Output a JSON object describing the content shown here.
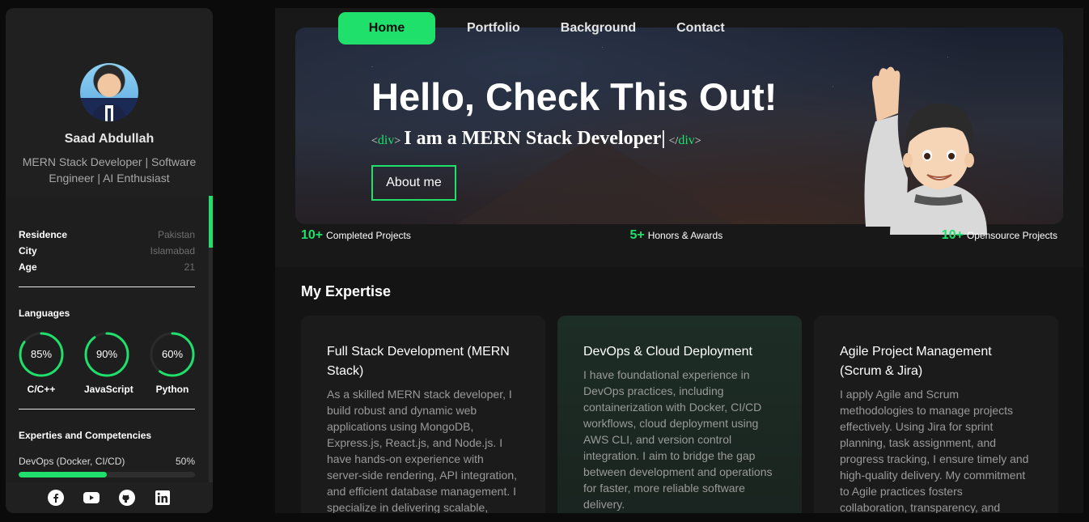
{
  "profile": {
    "name": "Saad Abdullah",
    "role": "MERN Stack Developer | Software Engineer | AI Enthusiast"
  },
  "info": [
    {
      "label": "Residence",
      "value": "Pakistan"
    },
    {
      "label": "City",
      "value": "Islamabad"
    },
    {
      "label": "Age",
      "value": "21"
    }
  ],
  "languages": {
    "title": "Languages",
    "items": [
      {
        "name": "C/C++",
        "percent": "85%",
        "value": 85
      },
      {
        "name": "JavaScript",
        "percent": "90%",
        "value": 90
      },
      {
        "name": "Python",
        "percent": "60%",
        "value": 60
      }
    ]
  },
  "expertise_sidebar": {
    "title": "Experties and Competencies",
    "items": [
      {
        "name": "DevOps (Docker, CI/CD)",
        "percent": "50%",
        "value": 50
      }
    ]
  },
  "socials": [
    "facebook-icon",
    "youtube-icon",
    "github-icon",
    "linkedin-icon"
  ],
  "nav": {
    "items": [
      "Home",
      "Portfolio",
      "Background",
      "Contact"
    ],
    "active": "Home"
  },
  "hero": {
    "title": "Hello, Check This Out!",
    "tag_open": "<",
    "tag_name": "div",
    "tag_close": ">",
    "tagline": "I am a MERN Stack Developer|",
    "end_tag_open": "</",
    "button": "About me"
  },
  "stats": [
    {
      "num": "10+",
      "label": "Completed Projects"
    },
    {
      "num": "5+",
      "label": "Honors & Awards"
    },
    {
      "num": "10+",
      "label": "Opensource Projects"
    }
  ],
  "expertise": {
    "title": "My Expertise",
    "cards": [
      {
        "title": "Full Stack Development (MERN Stack)",
        "text": "As a skilled MERN stack developer, I build robust and dynamic web applications using MongoDB, Express.js, React.js, and Node.js. I have hands-on experience with server-side rendering, API integration, and efficient database management. I specialize in delivering scalable,"
      },
      {
        "title": "DevOps & Cloud Deployment",
        "text": "I have foundational experience in DevOps practices, including containerization with Docker, CI/CD workflows, cloud deployment using AWS CLI, and version control integration. I aim to bridge the gap between development and operations for faster, more reliable software delivery."
      },
      {
        "title": "Agile Project Management (Scrum & Jira)",
        "text": "I apply Agile and Scrum methodologies to manage projects effectively. Using Jira for sprint planning, task assignment, and progress tracking, I ensure timely and high-quality delivery. My commitment to Agile practices fosters collaboration, transparency, and"
      }
    ]
  },
  "colors": {
    "accent": "#1ee06a",
    "bg": "#0b0b0b",
    "panel": "#1e1e1e"
  }
}
